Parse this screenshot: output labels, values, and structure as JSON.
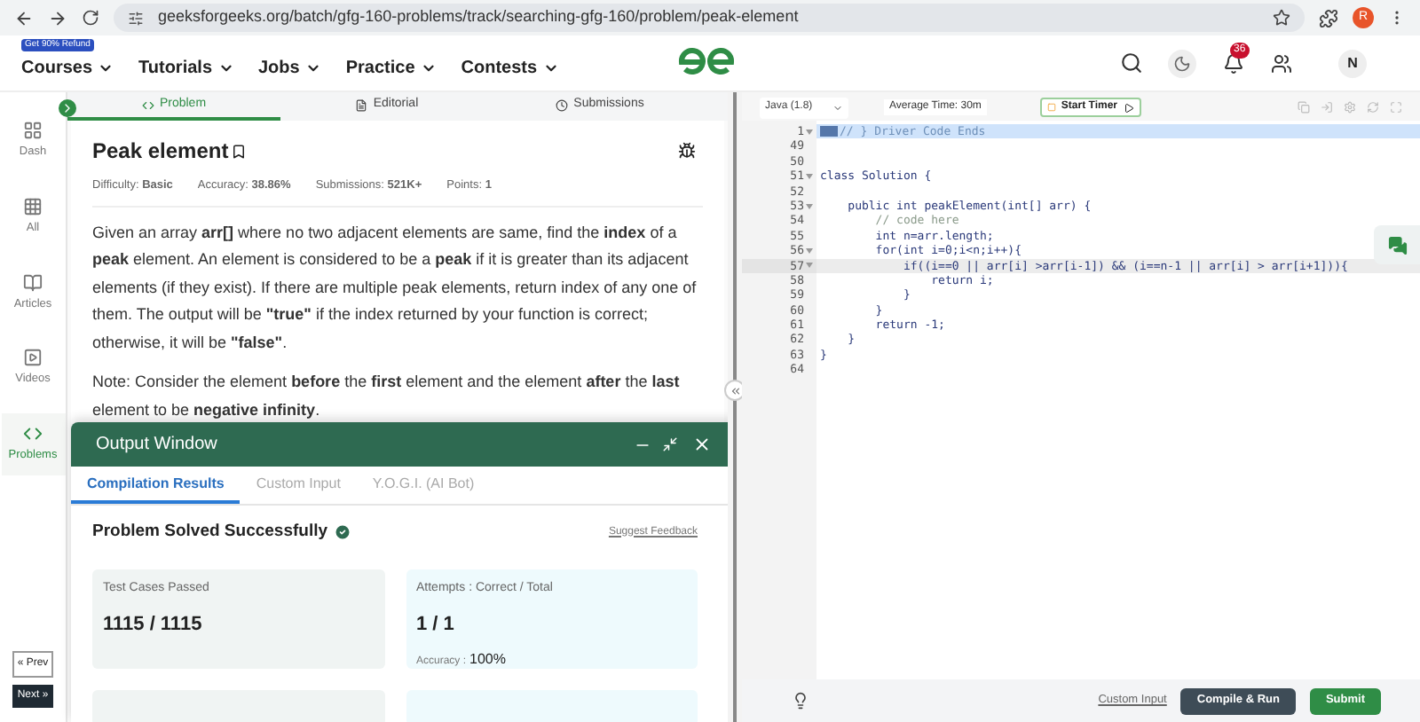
{
  "browser": {
    "url": "geeksforgeeks.org/batch/gfg-160-problems/track/searching-gfg-160/problem/peak-element",
    "profile": "R"
  },
  "nav": {
    "badge": "Get 90% Refund",
    "items": [
      {
        "label": "Courses"
      },
      {
        "label": "Tutorials"
      },
      {
        "label": "Jobs"
      },
      {
        "label": "Practice"
      },
      {
        "label": "Contests"
      }
    ],
    "notifications": "36",
    "avatar": "N"
  },
  "sidebar": {
    "items": [
      {
        "label": "Dash",
        "selected": false
      },
      {
        "label": "All",
        "selected": false
      },
      {
        "label": "Articles",
        "selected": false
      },
      {
        "label": "Videos",
        "selected": false
      },
      {
        "label": "Problems",
        "selected": true
      }
    ],
    "prev": "« Prev",
    "next": "Next »"
  },
  "problem_tabs": [
    {
      "label": "Problem",
      "selected": true
    },
    {
      "label": "Editorial",
      "selected": false
    },
    {
      "label": "Submissions",
      "selected": false
    }
  ],
  "problem": {
    "title": "Peak element",
    "meta": [
      "Difficulty: **Basic**",
      "Accuracy: **38.86%**",
      "Submissions: **521K+**",
      "Points: **1**"
    ],
    "paragraphs": [
      "Given an array **arr[]** where no two adjacent elements are same, find the **index** of a **peak** element. An element is considered to be a **peak** if it is greater than its adjacent elements (if they exist). If there are multiple peak elements, return index of any one of them. The output will be **\"true\"** if the index returned by your function is correct; otherwise, it will be **\"false\"**.",
      "Note: Consider the element **before** the **first** element and the element **after** the **last** element to be **negative infinity**."
    ]
  },
  "output_window": {
    "title": "Output Window",
    "tabs": [
      {
        "label": "Compilation Results",
        "selected": true
      },
      {
        "label": "Custom Input",
        "selected": false
      },
      {
        "label": "Y.O.G.I. (AI Bot)",
        "selected": false
      }
    ],
    "status": "Problem Solved Successfully",
    "feedback_link": "Suggest Feedback",
    "cards": [
      {
        "label": "Test Cases Passed",
        "value": "1115 / 1115"
      },
      {
        "label": "Attempts : Correct / Total",
        "value": "1 / 1",
        "extra_label": "Accuracy :",
        "extra_value": "100%"
      }
    ]
  },
  "editor": {
    "language": "Java (1.8)",
    "average_time": "Average Time: 30m",
    "timer_button": "Start Timer",
    "lines": [
      {
        "number": "1",
        "text": "// } Driver Code Ends",
        "kind": "selected",
        "fold": true
      },
      {
        "number": "49",
        "kind": "code",
        "fold": false
      },
      {
        "number": "50",
        "kind": "code",
        "fold": false
      },
      {
        "number": "51",
        "text": "class Solution {",
        "kind": "code",
        "fold": true
      },
      {
        "number": "52",
        "kind": "code",
        "fold": false
      },
      {
        "number": "53",
        "text": "    public int peakElement(int[] arr) {",
        "kind": "code",
        "fold": true
      },
      {
        "number": "54",
        "text": "        // code here",
        "kind": "comment",
        "fold": false
      },
      {
        "number": "55",
        "text": "        int n=arr.length;",
        "kind": "code",
        "fold": false
      },
      {
        "number": "56",
        "text": "        for(int i=0;i<n;i++){",
        "kind": "code",
        "fold": true
      },
      {
        "number": "57",
        "text": "            if((i==0 || arr[i] >arr[i-1]) && (i==n-1 || arr[i] > arr[i+1])){",
        "kind": "cursor",
        "fold": true
      },
      {
        "number": "58",
        "text": "                return i;",
        "kind": "code",
        "fold": false
      },
      {
        "number": "59",
        "text": "            }",
        "kind": "code",
        "fold": false
      },
      {
        "number": "60",
        "text": "        }",
        "kind": "code",
        "fold": false
      },
      {
        "number": "61",
        "text": "        return -1;",
        "kind": "code",
        "fold": false
      },
      {
        "number": "62",
        "text": "    }",
        "kind": "code",
        "fold": false
      },
      {
        "number": "63",
        "text": "}",
        "kind": "code",
        "fold": false
      },
      {
        "number": "64",
        "kind": "code",
        "fold": false
      }
    ],
    "custom_input": "Custom Input",
    "compile_run": "Compile & Run",
    "submit": "Submit"
  }
}
